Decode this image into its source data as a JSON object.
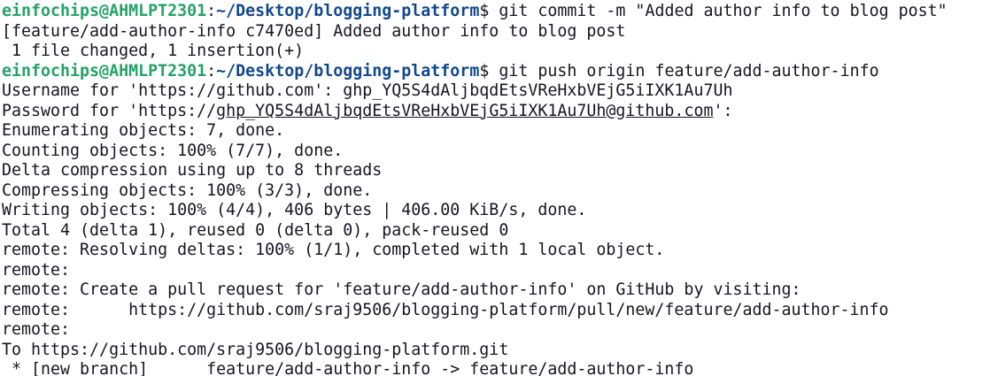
{
  "terminal": {
    "colors": {
      "background": "#ffffff",
      "text": "#171421",
      "prompt_user": "#26a269",
      "prompt_path": "#12488b"
    },
    "prompt": {
      "user_host": "einfochips@AHMLPT2301",
      "colon": ":",
      "path": "~/Desktop/blogging-platform",
      "symbol": "$"
    },
    "commands": {
      "commit": " git commit -m \"Added author info to blog post\"",
      "push": " git push origin feature/add-author-info"
    },
    "output": {
      "commit_line1": "[feature/add-author-info c7470ed] Added author info to blog post",
      "commit_line2": " 1 file changed, 1 insertion(+)",
      "username": "Username for 'https://github.com': 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",
      "password_prefix": "Password for 'https://",
      "password_link": "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@github.com",
      "password_suffix": "':",
      "lines": [
        "Enumerating objects: 7, done.",
        "Counting objects: 100% (7/7), done.",
        "Delta compression using up to 8 threads",
        "Compressing objects: 100% (3/3), done.",
        "Writing objects: 100% (4/4), 406 bytes | 406.00 KiB/s, done.",
        "Total 4 (delta 1), reused 0 (delta 0), pack-reused 0",
        "remote: Resolving deltas: 100% (1/1), completed with 1 local object.",
        "remote:",
        "remote: Create a pull request for 'feature/add-author-info' on GitHub by visiting:",
        "remote:      https://github.com/sraj9506/blogging-platform/pull/new/feature/add-author-info",
        "remote:",
        "To https://github.com/sraj9506/blogging-platform.git",
        " * [new branch]      feature/add-author-info -> feature/add-author-info"
      ]
    }
  }
}
